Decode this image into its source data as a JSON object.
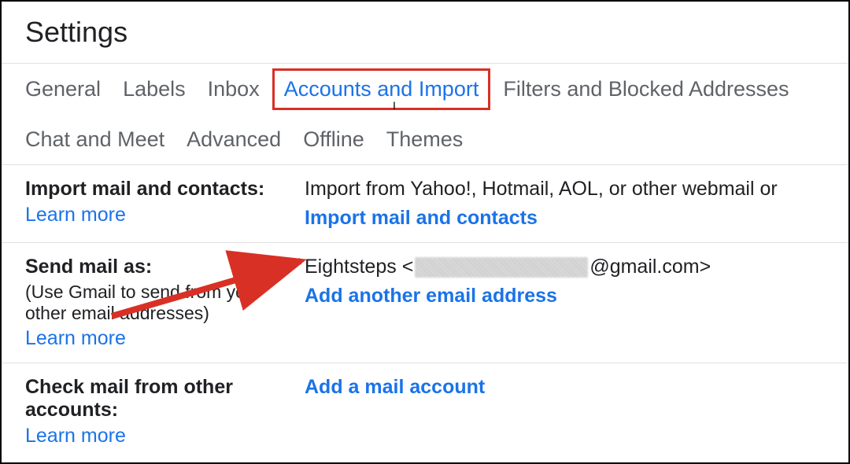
{
  "page_title": "Settings",
  "tabs": {
    "row1": [
      {
        "label": "General",
        "active": false
      },
      {
        "label": "Labels",
        "active": false
      },
      {
        "label": "Inbox",
        "active": false
      },
      {
        "label": "Accounts and Import",
        "active": true,
        "highlighted": true
      },
      {
        "label": "Filters and Blocked Addresses",
        "active": false
      }
    ],
    "row2": [
      {
        "label": "Chat and Meet",
        "active": false
      },
      {
        "label": "Advanced",
        "active": false
      },
      {
        "label": "Offline",
        "active": false
      },
      {
        "label": "Themes",
        "active": false
      }
    ]
  },
  "sections": {
    "import": {
      "label": "Import mail and contacts:",
      "learn_more": "Learn more",
      "description": "Import from Yahoo!, Hotmail, AOL, or other webmail or",
      "action": "Import mail and contacts"
    },
    "send_as": {
      "label": "Send mail as:",
      "sub": "(Use Gmail to send from your other email addresses)",
      "learn_more": "Learn more",
      "name": "Eightsteps",
      "email_prefix": "<",
      "email_suffix": "@gmail.com>",
      "action": "Add another email address"
    },
    "check_mail": {
      "label": "Check mail from other accounts:",
      "learn_more": "Learn more",
      "action": "Add a mail account"
    }
  }
}
